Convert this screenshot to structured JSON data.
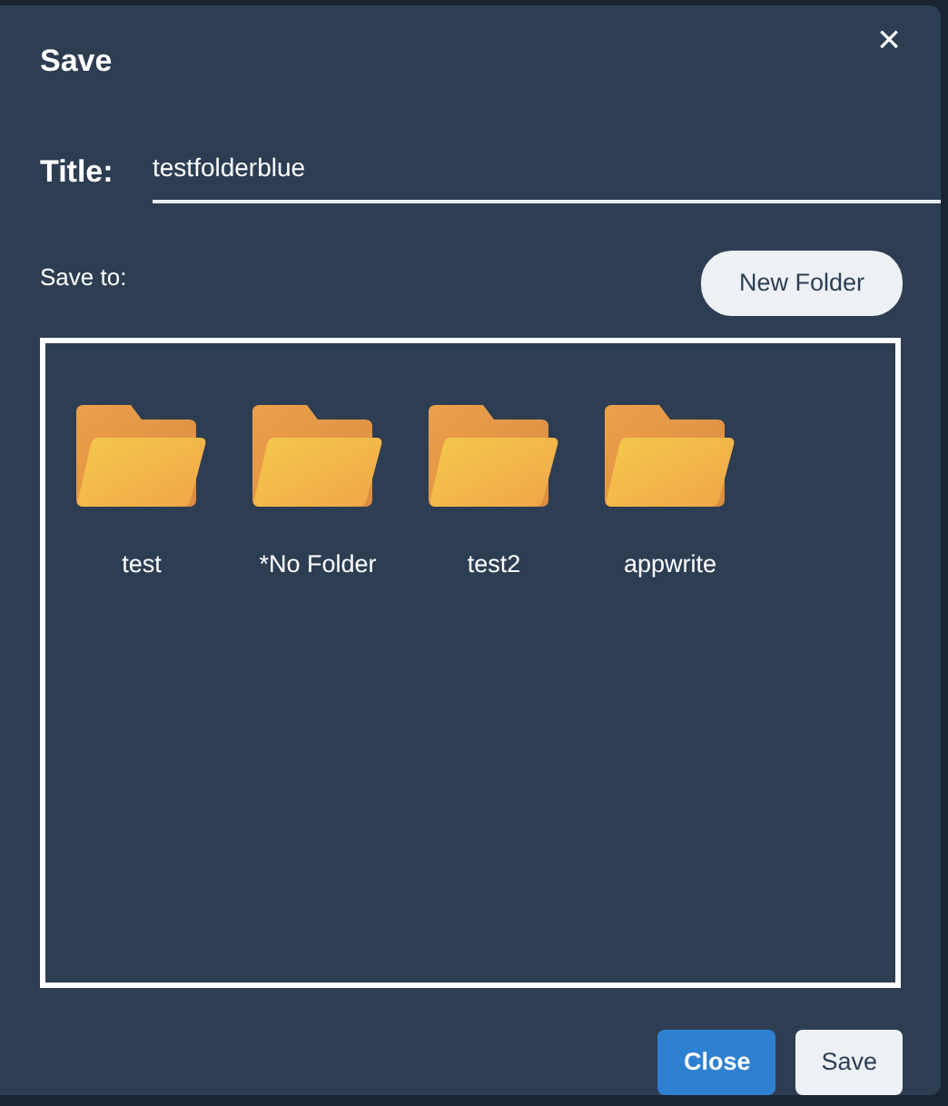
{
  "dialog": {
    "title": "Save",
    "close": "×"
  },
  "title_field": {
    "label": "Title:",
    "value": "testfolderblue"
  },
  "save_to": {
    "label": "Save to:",
    "new_folder_button": "New Folder"
  },
  "folders": [
    {
      "name": "test"
    },
    {
      "name": "*No Folder"
    },
    {
      "name": "test2"
    },
    {
      "name": "appwrite"
    }
  ],
  "buttons": [
    {
      "label": "Close",
      "primary": true
    },
    {
      "label": "Save",
      "primary": false
    }
  ]
}
